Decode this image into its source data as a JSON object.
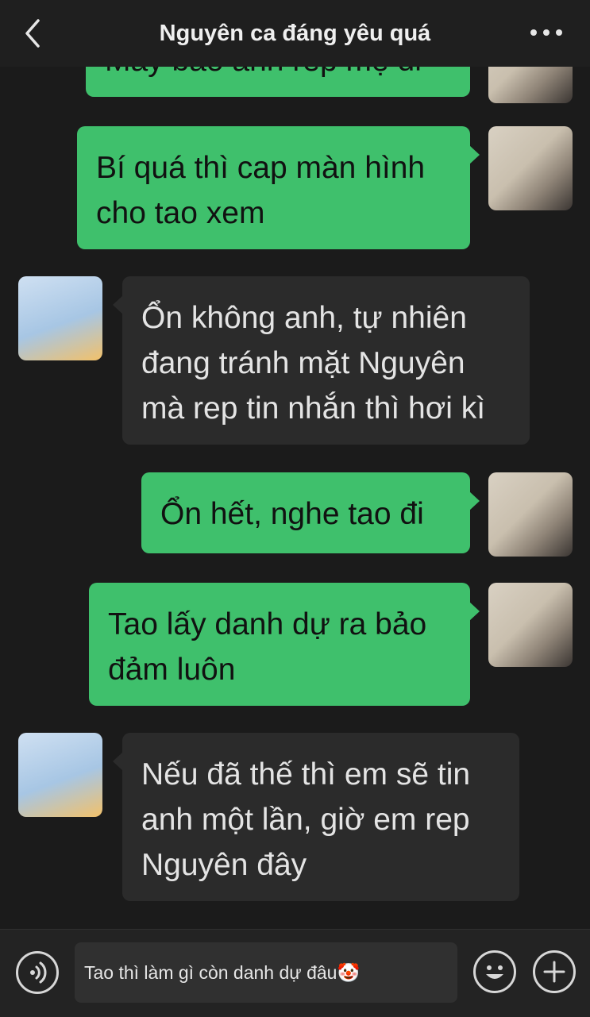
{
  "header": {
    "title": "Nguyên ca đáng yêu quá",
    "back_icon": "chevron-left-icon",
    "more_icon": "more-dots-icon"
  },
  "messages": [
    {
      "from": "me",
      "text": "Mày bảo anh rep mẹ đi"
    },
    {
      "from": "me",
      "text": "Bí quá thì cap màn hình cho tao xem"
    },
    {
      "from": "other",
      "text": "Ổn không anh, tự nhiên đang tránh mặt Nguyên mà rep tin nhắn thì hơi kì"
    },
    {
      "from": "me",
      "text": "Ổn hết, nghe tao đi"
    },
    {
      "from": "me",
      "text": "Tao lấy danh dự ra bảo đảm luôn"
    },
    {
      "from": "other",
      "text": "Nếu đã thế thì em sẽ tin anh một lần, giờ em rep Nguyên đây"
    }
  ],
  "input": {
    "value": "Tao thì làm gì còn danh dự đâu🤡",
    "voice_icon": "voice-icon",
    "emoji_icon": "emoji-icon",
    "plus_icon": "plus-icon"
  },
  "colors": {
    "background": "#1b1b1b",
    "outgoing_bubble": "#3fc06c",
    "incoming_bubble": "#2b2b2b",
    "header_text": "#efefef"
  }
}
